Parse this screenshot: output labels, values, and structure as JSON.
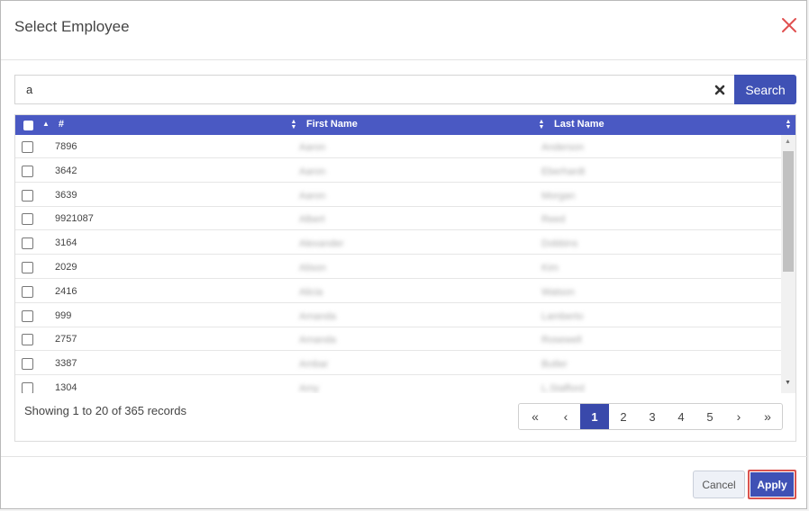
{
  "dialog": {
    "title": "Select Employee",
    "close_icon": "close-icon"
  },
  "search": {
    "value": "a",
    "clear_icon": "clear-x-icon",
    "button_label": "Search"
  },
  "table": {
    "columns": [
      "#",
      "First Name",
      "Last Name"
    ],
    "rows": [
      {
        "num": "7896",
        "first": "Aaron",
        "last": "Anderson"
      },
      {
        "num": "3642",
        "first": "Aaron",
        "last": "Eberhardt"
      },
      {
        "num": "3639",
        "first": "Aaron",
        "last": "Morgan"
      },
      {
        "num": "9921087",
        "first": "Albert",
        "last": "Reed"
      },
      {
        "num": "3164",
        "first": "Alexander",
        "last": "Dobbins"
      },
      {
        "num": "2029",
        "first": "Alison",
        "last": "Kim"
      },
      {
        "num": "2416",
        "first": "Alicia",
        "last": "Watson"
      },
      {
        "num": "999",
        "first": "Amanda",
        "last": "Lamberto"
      },
      {
        "num": "2757",
        "first": "Amanda",
        "last": "Rosewell"
      },
      {
        "num": "3387",
        "first": "Ambar",
        "last": "Butler"
      },
      {
        "num": "1304",
        "first": "Amy",
        "last": "L.Stafford"
      }
    ]
  },
  "footer": {
    "info": "Showing 1 to 20 of 365 records"
  },
  "pagination": {
    "first": "«",
    "prev": "‹",
    "pages": [
      "1",
      "2",
      "3",
      "4",
      "5"
    ],
    "active_page": "1",
    "next": "›",
    "last": "»"
  },
  "buttons": {
    "cancel": "Cancel",
    "apply": "Apply"
  },
  "colors": {
    "accent": "#3f51b5",
    "header_bar": "#4a59c3",
    "close": "#e05050",
    "apply_border": "#d9534f"
  }
}
